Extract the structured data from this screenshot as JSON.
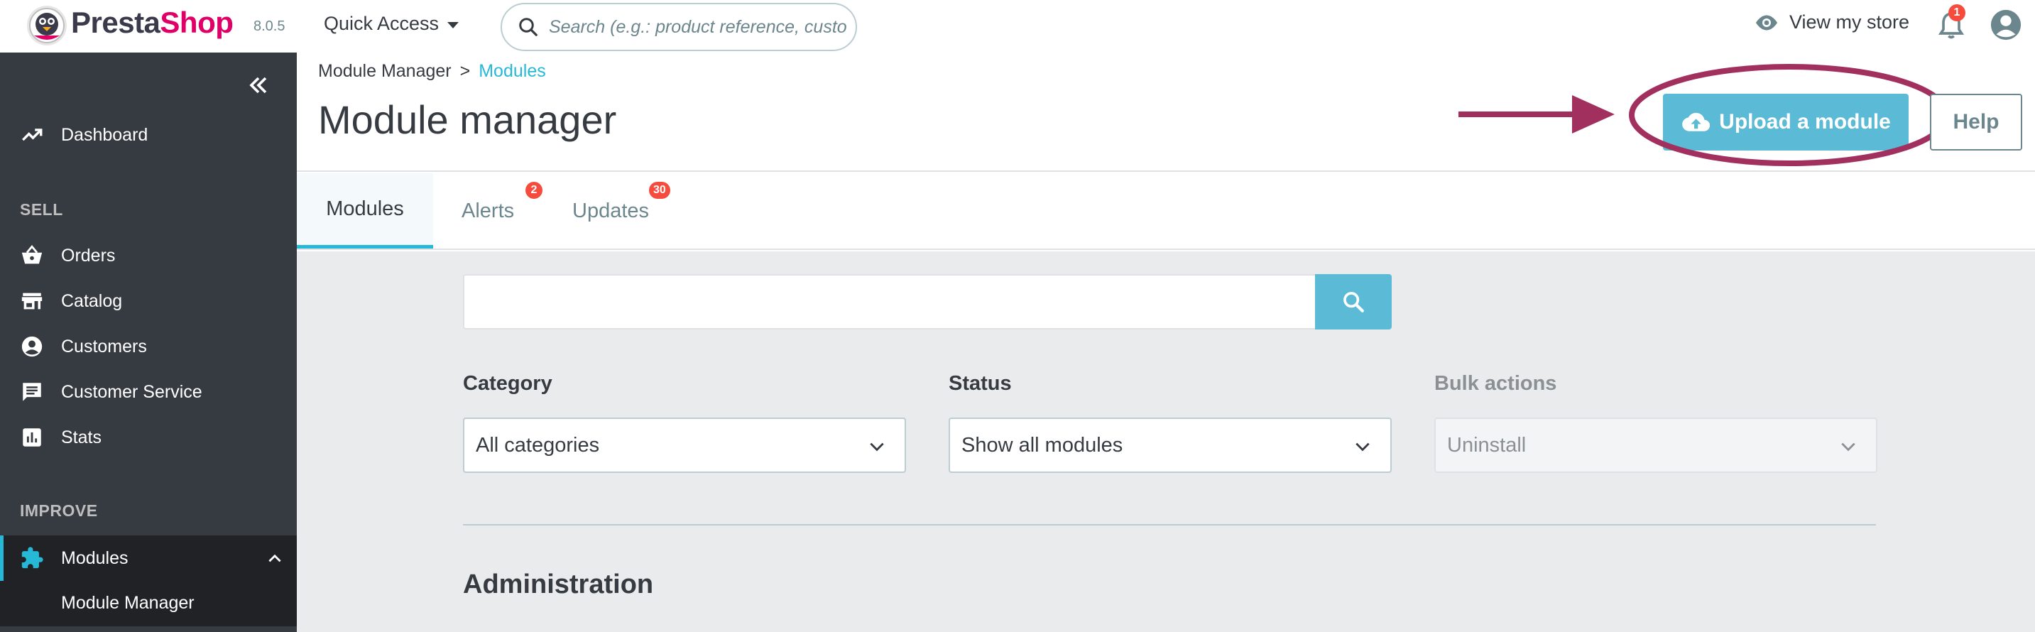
{
  "topbar": {
    "brand_presta": "Presta",
    "brand_shop": "Shop",
    "version": "8.0.5",
    "quick_access": "Quick Access",
    "search_placeholder": "Search (e.g.: product reference, custon",
    "view_store": "View my store",
    "notification_count": "1"
  },
  "sidebar": {
    "dashboard": "Dashboard",
    "sell_title": "SELL",
    "orders": "Orders",
    "catalog": "Catalog",
    "customers": "Customers",
    "customer_service": "Customer Service",
    "stats": "Stats",
    "improve_title": "IMPROVE",
    "modules": "Modules",
    "module_manager": "Module Manager"
  },
  "header": {
    "breadcrumb_parent": "Module Manager",
    "breadcrumb_sep": ">",
    "breadcrumb_current": "Modules",
    "title": "Module manager",
    "upload_label": "Upload a module",
    "help_label": "Help"
  },
  "tabs": [
    {
      "label": "Modules",
      "badge": ""
    },
    {
      "label": "Alerts",
      "badge": "2"
    },
    {
      "label": "Updates",
      "badge": "30"
    }
  ],
  "filters": {
    "category_label": "Category",
    "category_value": "All categories",
    "status_label": "Status",
    "status_value": "Show all modules",
    "bulk_label": "Bulk actions",
    "bulk_value": "Uninstall"
  },
  "section_heading": "Administration",
  "colors": {
    "accent": "#25b9d7",
    "button": "#5bbad5",
    "sidebar": "#363a41",
    "annotation": "#a2305f",
    "badge": "#f54c3e"
  }
}
